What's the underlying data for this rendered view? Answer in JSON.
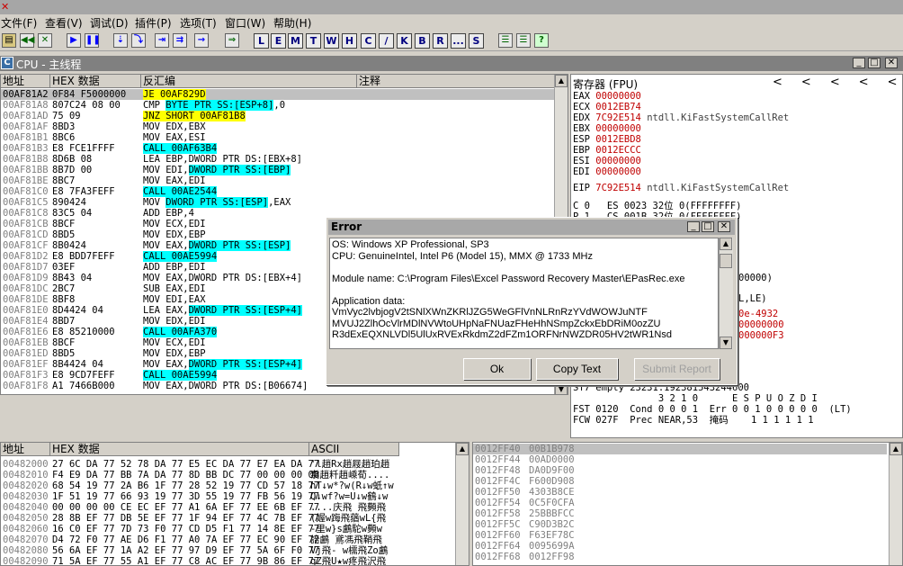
{
  "menu": [
    "文件(F)",
    "查看(V)",
    "调试(D)",
    "插件(P)",
    "选项(T)",
    "窗口(W)",
    "帮助(H)"
  ],
  "toolbar_letters": [
    "L",
    "E",
    "M",
    "T",
    "W",
    "H",
    "C",
    "/",
    "K",
    "B",
    "R",
    "...",
    "S"
  ],
  "cpu_window": {
    "title": "CPU - 主线程"
  },
  "disasm": {
    "headers": [
      "地址",
      "HEX 数据",
      "反汇编",
      "注释"
    ],
    "rows": [
      {
        "addr": "00AF81A2",
        "hex": "0F84 F5000000",
        "pre": "",
        "hl": "JE 00AF829D",
        "post": "",
        "kind": "jmp",
        "sel": true
      },
      {
        "addr": "00AF81A8",
        "hex": "807C24 08 00",
        "pre": "CMP ",
        "hl": "BYTE PTR SS:[ESP+8]",
        "post": ",0",
        "kind": "mem"
      },
      {
        "addr": "00AF81AD",
        "hex": "75 09",
        "pre": "",
        "hl": "JNZ SHORT 00AF81B8",
        "post": "",
        "kind": "jmp"
      },
      {
        "addr": "00AF81AF",
        "hex": "8BD3",
        "pre": "MOV EDX,EBX",
        "hl": "",
        "post": "",
        "kind": ""
      },
      {
        "addr": "00AF81B1",
        "hex": "8BC6",
        "pre": "MOV EAX,ESI",
        "hl": "",
        "post": "",
        "kind": ""
      },
      {
        "addr": "00AF81B3",
        "hex": "E8 FCE1FFFF",
        "pre": "",
        "hl": "CALL 00AF63B4",
        "post": "",
        "kind": "call"
      },
      {
        "addr": "00AF81B8",
        "hex": "8D6B 08",
        "pre": "LEA EBP,DWORD PTR DS:[EBX+8]",
        "hl": "",
        "post": "",
        "kind": ""
      },
      {
        "addr": "00AF81BB",
        "hex": "8B7D 00",
        "pre": "MOV EDI,",
        "hl": "DWORD PTR SS:[EBP]",
        "post": "",
        "kind": "mem"
      },
      {
        "addr": "00AF81BE",
        "hex": "8BC7",
        "pre": "MOV EAX,EDI",
        "hl": "",
        "post": "",
        "kind": ""
      },
      {
        "addr": "00AF81C0",
        "hex": "E8 7FA3FEFF",
        "pre": "",
        "hl": "CALL 00AE2544",
        "post": "",
        "kind": "call"
      },
      {
        "addr": "00AF81C5",
        "hex": "890424",
        "pre": "MOV ",
        "hl": "DWORD PTR SS:[ESP]",
        "post": ",EAX",
        "kind": "mem"
      },
      {
        "addr": "00AF81C8",
        "hex": "83C5 04",
        "pre": "ADD EBP,4",
        "hl": "",
        "post": "",
        "kind": ""
      },
      {
        "addr": "00AF81CB",
        "hex": "8BCF",
        "pre": "MOV ECX,EDI",
        "hl": "",
        "post": "",
        "kind": ""
      },
      {
        "addr": "00AF81CD",
        "hex": "8BD5",
        "pre": "MOV EDX,EBP",
        "hl": "",
        "post": "",
        "kind": ""
      },
      {
        "addr": "00AF81CF",
        "hex": "8B0424",
        "pre": "MOV EAX,",
        "hl": "DWORD PTR SS:[ESP]",
        "post": "",
        "kind": "mem"
      },
      {
        "addr": "00AF81D2",
        "hex": "E8 BDD7FEFF",
        "pre": "",
        "hl": "CALL 00AE5994",
        "post": "",
        "kind": "call"
      },
      {
        "addr": "00AF81D7",
        "hex": "03EF",
        "pre": "ADD EBP,EDI",
        "hl": "",
        "post": "",
        "kind": ""
      },
      {
        "addr": "00AF81D9",
        "hex": "8B43 04",
        "pre": "MOV EAX,DWORD PTR DS:[EBX+4]",
        "hl": "",
        "post": "",
        "kind": ""
      },
      {
        "addr": "00AF81DC",
        "hex": "2BC7",
        "pre": "SUB EAX,EDI",
        "hl": "",
        "post": "",
        "kind": ""
      },
      {
        "addr": "00AF81DE",
        "hex": "8BF8",
        "pre": "MOV EDI,EAX",
        "hl": "",
        "post": "",
        "kind": ""
      },
      {
        "addr": "00AF81E0",
        "hex": "8D4424 04",
        "pre": "LEA EAX,",
        "hl": "DWORD PTR SS:[ESP+4]",
        "post": "",
        "kind": "mem"
      },
      {
        "addr": "00AF81E4",
        "hex": "8BD7",
        "pre": "MOV EDX,EDI",
        "hl": "",
        "post": "",
        "kind": ""
      },
      {
        "addr": "00AF81E6",
        "hex": "E8 85210000",
        "pre": "",
        "hl": "CALL 00AFA370",
        "post": "",
        "kind": "call"
      },
      {
        "addr": "00AF81EB",
        "hex": "8BCF",
        "pre": "MOV ECX,EDI",
        "hl": "",
        "post": "",
        "kind": ""
      },
      {
        "addr": "00AF81ED",
        "hex": "8BD5",
        "pre": "MOV EDX,EBP",
        "hl": "",
        "post": "",
        "kind": ""
      },
      {
        "addr": "00AF81EF",
        "hex": "8B4424 04",
        "pre": "MOV EAX,",
        "hl": "DWORD PTR SS:[ESP+4]",
        "post": "",
        "kind": "mem"
      },
      {
        "addr": "00AF81F3",
        "hex": "E8 9CD7FEFF",
        "pre": "",
        "hl": "CALL 00AE5994",
        "post": "",
        "kind": "call"
      },
      {
        "addr": "00AF81F8",
        "hex": "A1 7466B000",
        "pre": "MOV EAX,DWORD PTR DS:[B06674]",
        "hl": "",
        "post": "",
        "kind": ""
      }
    ]
  },
  "registers": {
    "title": "寄存器 (FPU)",
    "nav": [
      "<",
      "<",
      "<",
      "<",
      "<"
    ],
    "lines": [
      {
        "n": "EAX",
        "v": "00000000",
        "c": ""
      },
      {
        "n": "ECX",
        "v": "0012EB74",
        "c": ""
      },
      {
        "n": "EDX",
        "v": "7C92E514",
        "c": "ntdll.KiFastSystemCallRet"
      },
      {
        "n": "EBX",
        "v": "00000000",
        "c": ""
      },
      {
        "n": "ESP",
        "v": "0012EBD8",
        "c": ""
      },
      {
        "n": "EBP",
        "v": "0012ECCC",
        "c": ""
      },
      {
        "n": "ESI",
        "v": "00000000",
        "c": ""
      },
      {
        "n": "EDI",
        "v": "00000000",
        "c": ""
      },
      {
        "n": "",
        "v": "",
        "c": ""
      },
      {
        "n": "EIP",
        "v": "7C92E514",
        "c": "ntdll.KiFastSystemCallRet"
      }
    ],
    "flags": [
      "C 0   ES 0023 32位 0(FFFFFFFF)",
      "P 1   CS 001B 32位 0(FFFFFFFF)"
    ],
    "partial": [
      "00000)",
      "L,LE)",
      "0e-4932",
      "00000000",
      "000000F3"
    ],
    "fpu": [
      "ST7 empty 23231.192381543244600",
      "               3 2 1 0      E S P U O Z D I",
      "FST 0120  Cond 0 0 0 1  Err 0 0 1 0 0 0 0 0  (LT)",
      "FCW 027F  Prec NEAR,53  掩码    1 1 1 1 1 1"
    ]
  },
  "dump": {
    "headers": [
      "地址",
      "HEX 数据",
      "ASCII"
    ],
    "rows": [
      {
        "a": "00482000",
        "h": "27 6C DA 77 52 78 DA 77 E5 EC DA 77 E7 EA DA 77",
        "s": "'l趙Rx趙屐趙珀趙"
      },
      {
        "a": "00482010",
        "h": "F4 E9 DA 77 BB 7A DA 77 8D BB DC 77 00 00 00 00",
        "s": "翥趙粁趙嵊荀...."
      },
      {
        "a": "00482020",
        "h": "68 54 19 77 2A B6 1F 77 28 52 19 77 CD 57 18 77",
        "s": "hT↓w*?w(R↓w蚔↑w"
      },
      {
        "a": "00482030",
        "h": "1F 51 19 77 66 93 19 77 3D 55 19 77 FB 56 19 77",
        "s": "Q↓wf?w=U↓w鶴↓w"
      },
      {
        "a": "00482040",
        "h": "00 00 00 00 CE EC EF 77 A1 6A EF 77 EE 6B EF 77",
        "s": "....庆飛 飛顭飛"
      },
      {
        "a": "00482050",
        "h": "28 8B EF 77 DB 5E EF 77 1F 94 EF 77 4C 7B EF 77",
        "s": "(媉w踇飛蕕wL{飛"
      },
      {
        "a": "00482060",
        "h": "16 C0 EF 77 7D 73 F0 77 CD D5 F1 77 14 8E EF 77",
        "s": "-里w}s鸕駝w顭w"
      },
      {
        "a": "00482070",
        "h": "D4 72 F0 77 AE D6 F1 77 A0 7A EF 77 EC 90 EF 77",
        "s": "詒鸕 鳶馮飛鞘飛"
      },
      {
        "a": "00482080",
        "h": "56 6A EF 77 1A A2 EF 77 97 D9 EF 77 5A 6F F0 77",
        "s": "Vj飛- w檽飛Zo鸕"
      },
      {
        "a": "00482090",
        "h": "71 5A EF 77 55 A1 EF 77 C8 AC EF 77 9B 86 EF 77",
        "s": "qZ飛U★w疼飛沢飛"
      }
    ]
  },
  "stack": {
    "rows": [
      {
        "a": "0012FF40",
        "v": "00B1B978"
      },
      {
        "a": "0012FF44",
        "v": "00AD0000"
      },
      {
        "a": "0012FF48",
        "v": "DA0D9F00"
      },
      {
        "a": "0012FF4C",
        "v": "F600D908"
      },
      {
        "a": "0012FF50",
        "v": "4303B8CE"
      },
      {
        "a": "0012FF54",
        "v": "0C5F0CFA"
      },
      {
        "a": "0012FF58",
        "v": "25BBBFCC"
      },
      {
        "a": "0012FF5C",
        "v": "C90D3B2C"
      },
      {
        "a": "0012FF60",
        "v": "F63EF78C"
      },
      {
        "a": "0012FF64",
        "v": "0095699A"
      },
      {
        "a": "0012FF68",
        "v": "0012FF98"
      }
    ]
  },
  "dialog": {
    "title": "Error",
    "lines": [
      "OS: Windows XP Professional, SP3",
      "CPU: GenuineIntel, Intel P6 (Model 15), MMX @ 1733 MHz",
      "",
      "Module name: C:\\Program Files\\Excel Password Recovery Master\\EPasRec.exe",
      "",
      "Application data:",
      "VmVyc2lvbjogV2tSNlXWnZKRlJZG5WeGFlVnNLRnRzYVdWOWJuNTF",
      "MVUJ2ZlhOcVlrMDlNVWtoUHpNaFNUazFHeHhNSmpZckxEbDRiM0ozZU",
      "R3dExEQXNLVDl5UlUxRVExRkdmZ2dFZm1ORFNrNWZDR05HV2tWR1Nsd"
    ],
    "ok": "Ok",
    "copy": "Copy Text",
    "submit": "Submit Report"
  }
}
